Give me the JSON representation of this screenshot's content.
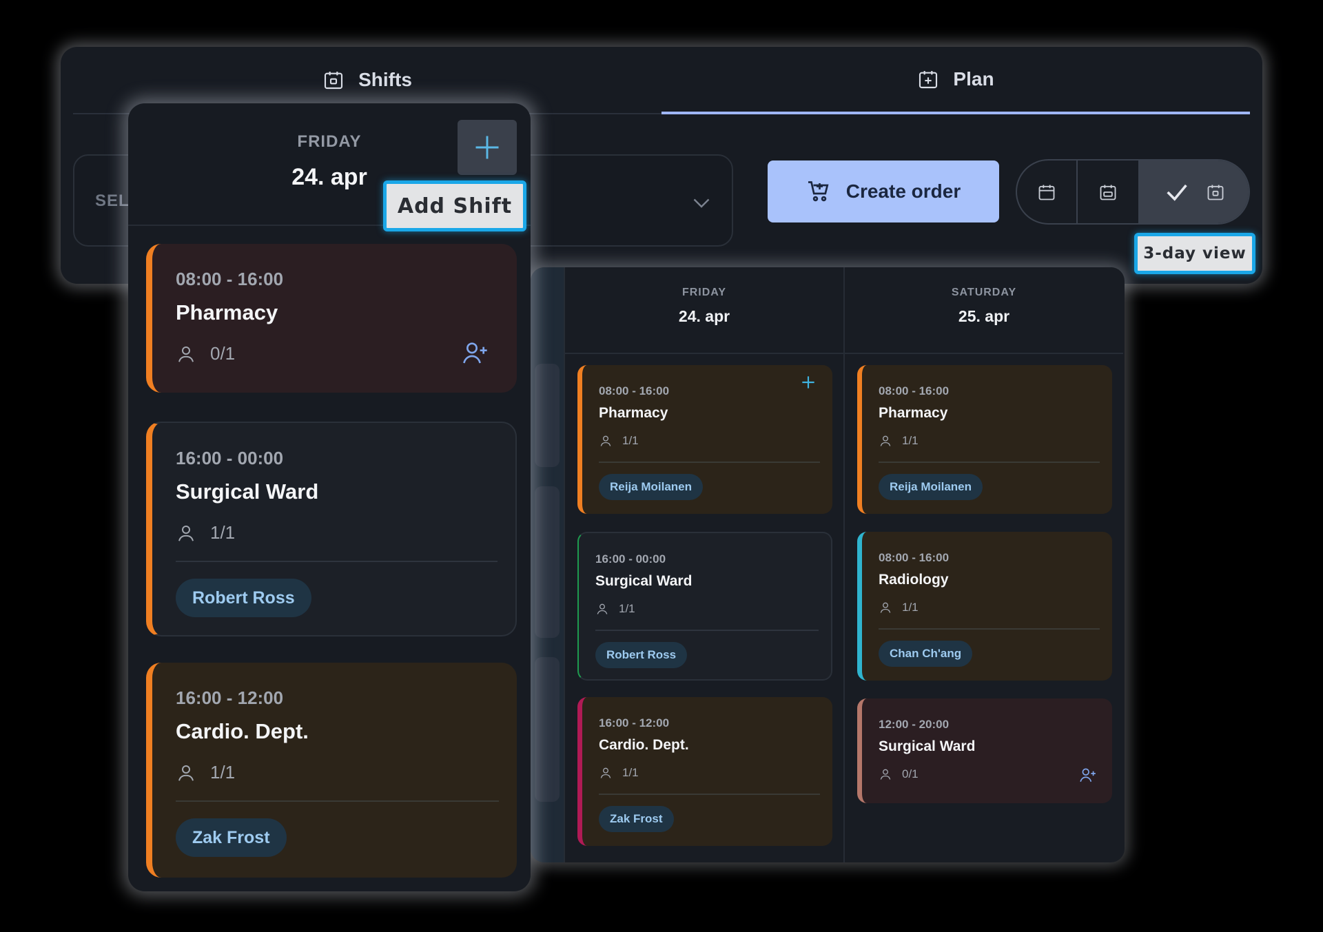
{
  "tabs": [
    {
      "label": "Shifts",
      "icon": "calendar-day-icon"
    },
    {
      "label": "Plan",
      "icon": "calendar-plus-icon"
    }
  ],
  "select": {
    "placeholder": "SEL"
  },
  "toolbar": {
    "create_order_label": "Create order",
    "view_tooltip": "3-day view"
  },
  "day_panel": {
    "day": "FRIDAY",
    "date": "24. apr",
    "add_tooltip": "Add Shift",
    "shifts": [
      {
        "time": "08:00 - 16:00",
        "name": "Pharmacy",
        "staffing": "0/1",
        "person": ""
      },
      {
        "time": "16:00 - 00:00",
        "name": "Surgical Ward",
        "staffing": "1/1",
        "person": "Robert Ross"
      },
      {
        "time": "16:00 - 12:00",
        "name": "Cardio. Dept.",
        "staffing": "1/1",
        "person": "Zak Frost"
      }
    ]
  },
  "calendar": {
    "columns": [
      {
        "day": "FRIDAY",
        "date": "24. apr",
        "shifts": [
          {
            "time": "08:00 - 16:00",
            "name": "Pharmacy",
            "staffing": "1/1",
            "person": "Reija Moilanen"
          },
          {
            "time": "16:00 - 00:00",
            "name": "Surgical Ward",
            "staffing": "1/1",
            "person": "Robert Ross"
          },
          {
            "time": "16:00 - 12:00",
            "name": "Cardio. Dept.",
            "staffing": "1/1",
            "person": "Zak Frost"
          }
        ]
      },
      {
        "day": "SATURDAY",
        "date": "25. apr",
        "shifts": [
          {
            "time": "08:00 - 16:00",
            "name": "Pharmacy",
            "staffing": "1/1",
            "person": "Reija Moilanen"
          },
          {
            "time": "08:00 - 16:00",
            "name": "Radiology",
            "staffing": "1/1",
            "person": "Chan Ch'ang"
          },
          {
            "time": "12:00 - 20:00",
            "name": "Surgical Ward",
            "staffing": "0/1",
            "person": ""
          }
        ]
      }
    ]
  },
  "colors": {
    "accent": "#a9c2fb",
    "tooltip_border": "#1aa7e8",
    "pharmacy": "#f07f22",
    "surgical_ward": "#1e9b4f",
    "cardio": "#b01a55",
    "radiology": "#2fb4cf"
  }
}
